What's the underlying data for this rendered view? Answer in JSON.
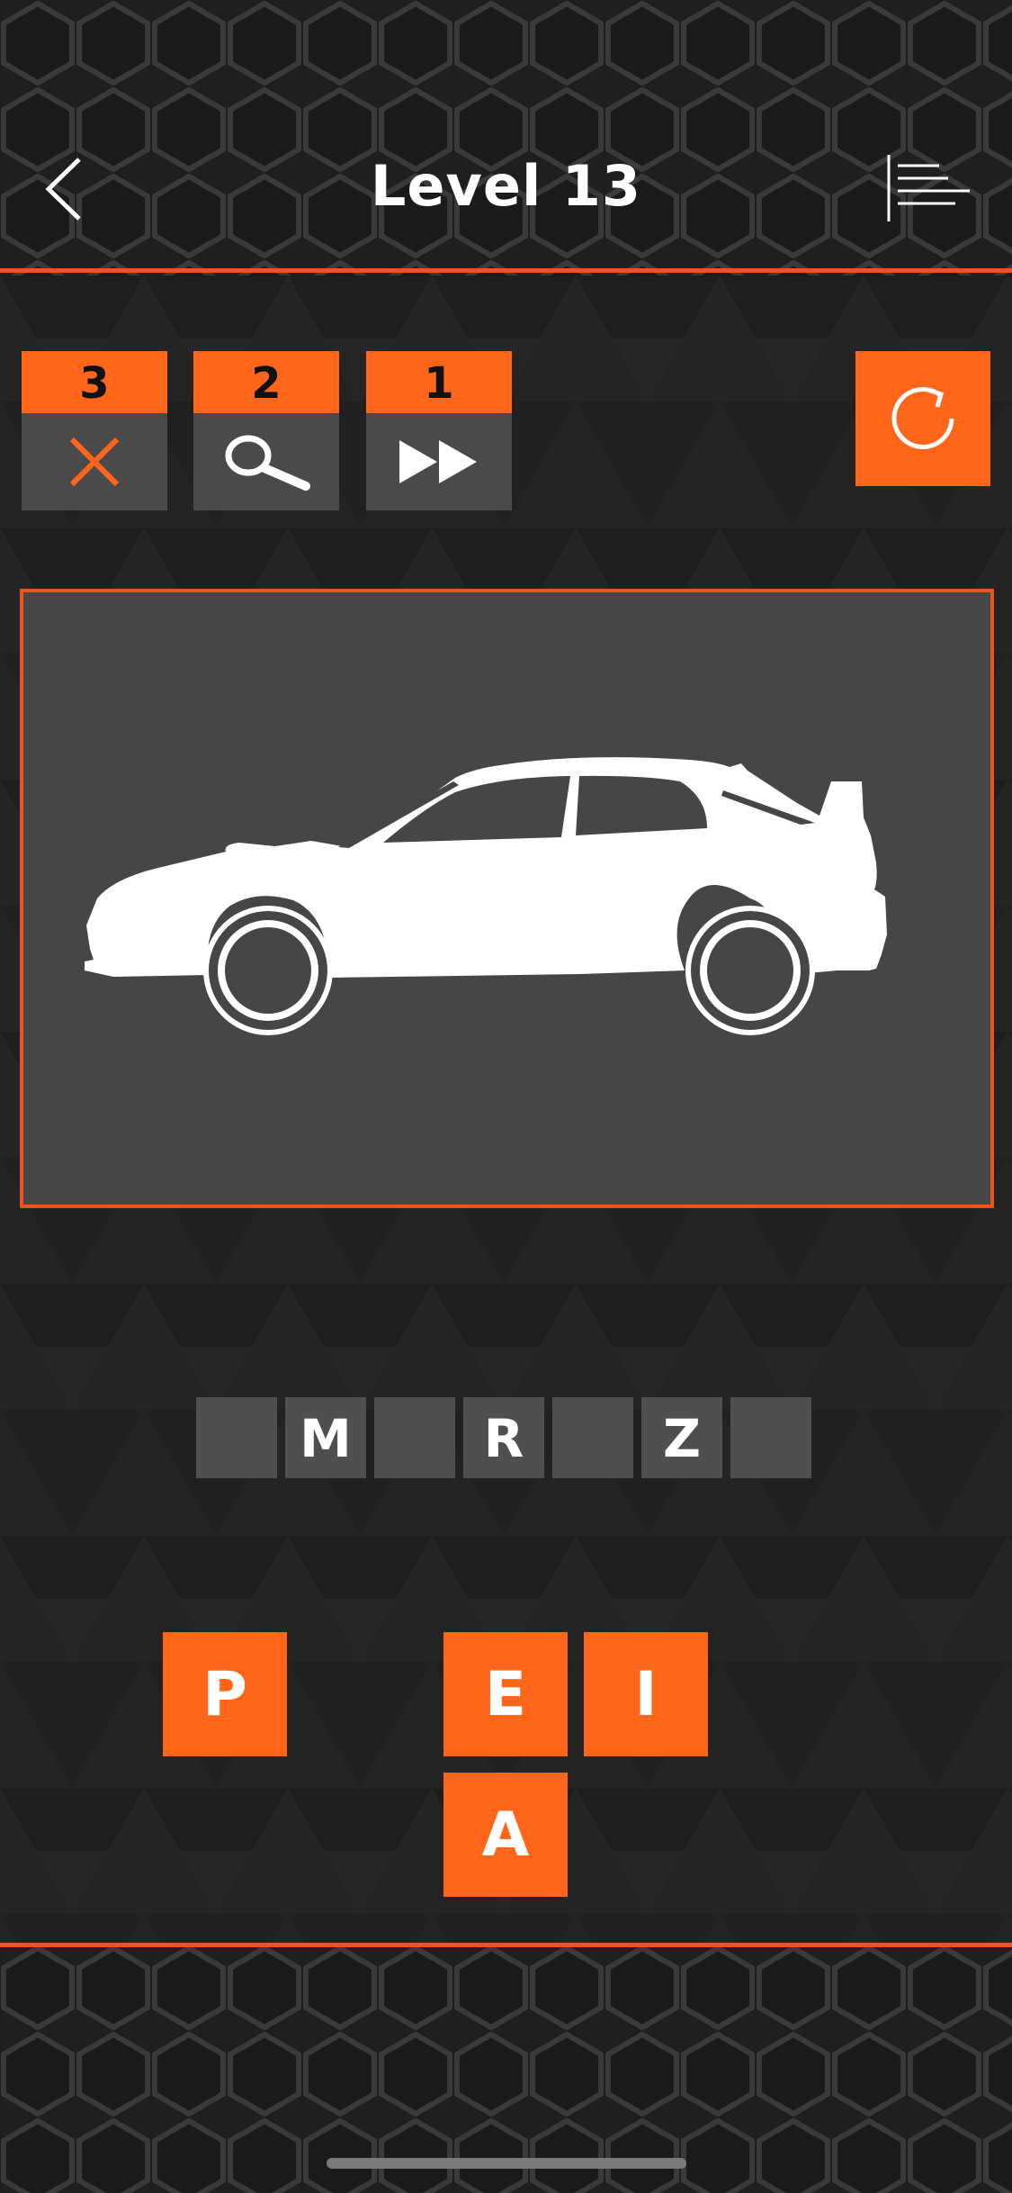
{
  "header": {
    "title": "Level 13"
  },
  "hints": [
    {
      "count": "3",
      "icon": "remove-letter-icon"
    },
    {
      "count": "2",
      "icon": "reveal-letter-icon"
    },
    {
      "count": "1",
      "icon": "skip-level-icon"
    }
  ],
  "puzzle": {
    "image": "car-silhouette-sedan",
    "slots": [
      "",
      "M",
      "",
      "R",
      "",
      "Z",
      ""
    ]
  },
  "letters": [
    "P",
    "E",
    "I",
    "A"
  ],
  "colors": {
    "accent": "#ff6619",
    "accent_line": "#e8561a",
    "background": "#222222",
    "slot": "#4f4f4f",
    "image_bg": "#464646"
  }
}
